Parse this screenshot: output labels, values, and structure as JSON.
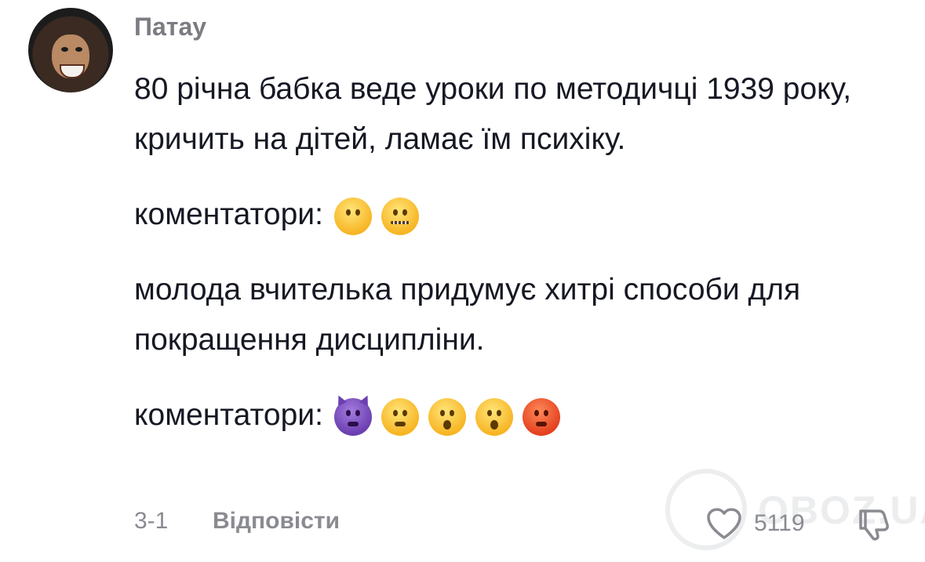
{
  "comment": {
    "username": "Патау",
    "lines": {
      "p1": "80 річна бабка веде уроки по методичці 1939 року, кричить на дітей, ламає їм психіку.",
      "p2": "коментатори:",
      "p3": "молода вчителька придумує хитрі способи для покращення дисципліни.",
      "p4": "коментатори:"
    },
    "reactions_1": [
      "face-without-mouth-emoji",
      "zipper-mouth-face-emoji"
    ],
    "reactions_2": [
      "smiling-face-with-horns-emoji",
      "anxious-face-emoji",
      "astonished-face-emoji",
      "hushed-face-emoji",
      "angry-face-emoji"
    ],
    "date": "3-1",
    "reply_label": "Відповісти",
    "like_count": "5119",
    "icons": {
      "like": "heart-outline-icon",
      "dislike": "thumbs-down-outline-icon"
    },
    "colors": {
      "text": "#161823",
      "muted": "#8a8b91",
      "username": "#7b7c82"
    }
  },
  "watermark": {
    "text": "OBOZ.UA"
  }
}
